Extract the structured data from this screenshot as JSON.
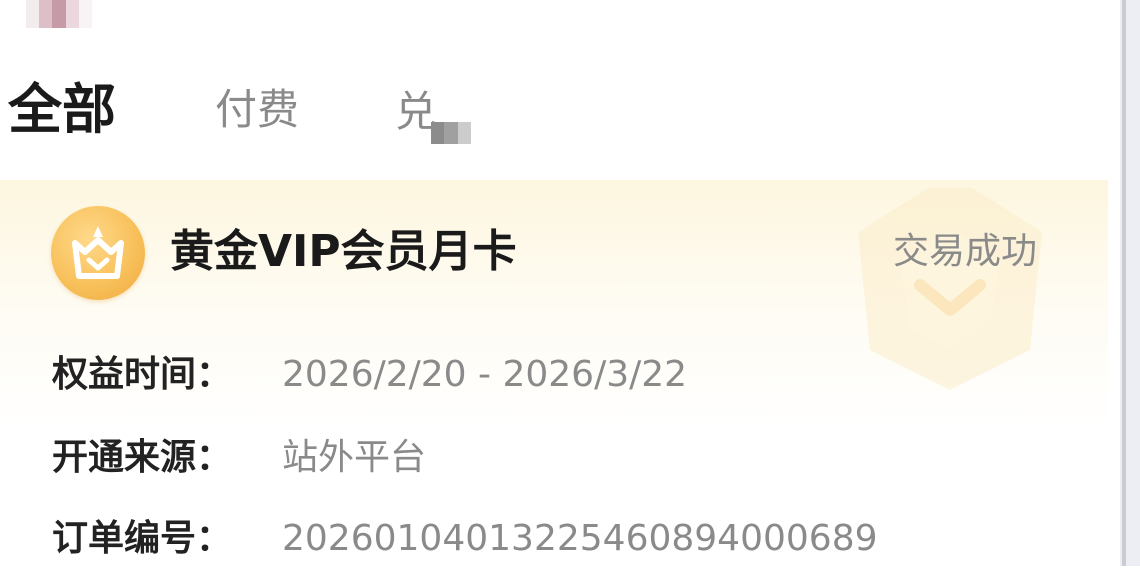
{
  "tabs": [
    {
      "label": "全部",
      "active": true
    },
    {
      "label": "付费",
      "active": false
    },
    {
      "label": "(partially obscured)",
      "active": false
    }
  ],
  "order": {
    "product_icon": "crown-icon",
    "title": "黄金VIP会员月卡",
    "status": "交易成功",
    "benefit_time_label": "权益时间：",
    "benefit_time_value": "2026/2/20 - 2026/3/22",
    "source_label": "开通来源：",
    "source_value": "站外平台",
    "order_no_label": "订单编号：",
    "order_no_value": "2026010401322546089400068​9"
  },
  "colors": {
    "accent_gold": "#f8c15c",
    "card_gradient_top": "#fdf6df",
    "title_text": "#1a1a1a",
    "muted_text": "#8a8a8a"
  }
}
